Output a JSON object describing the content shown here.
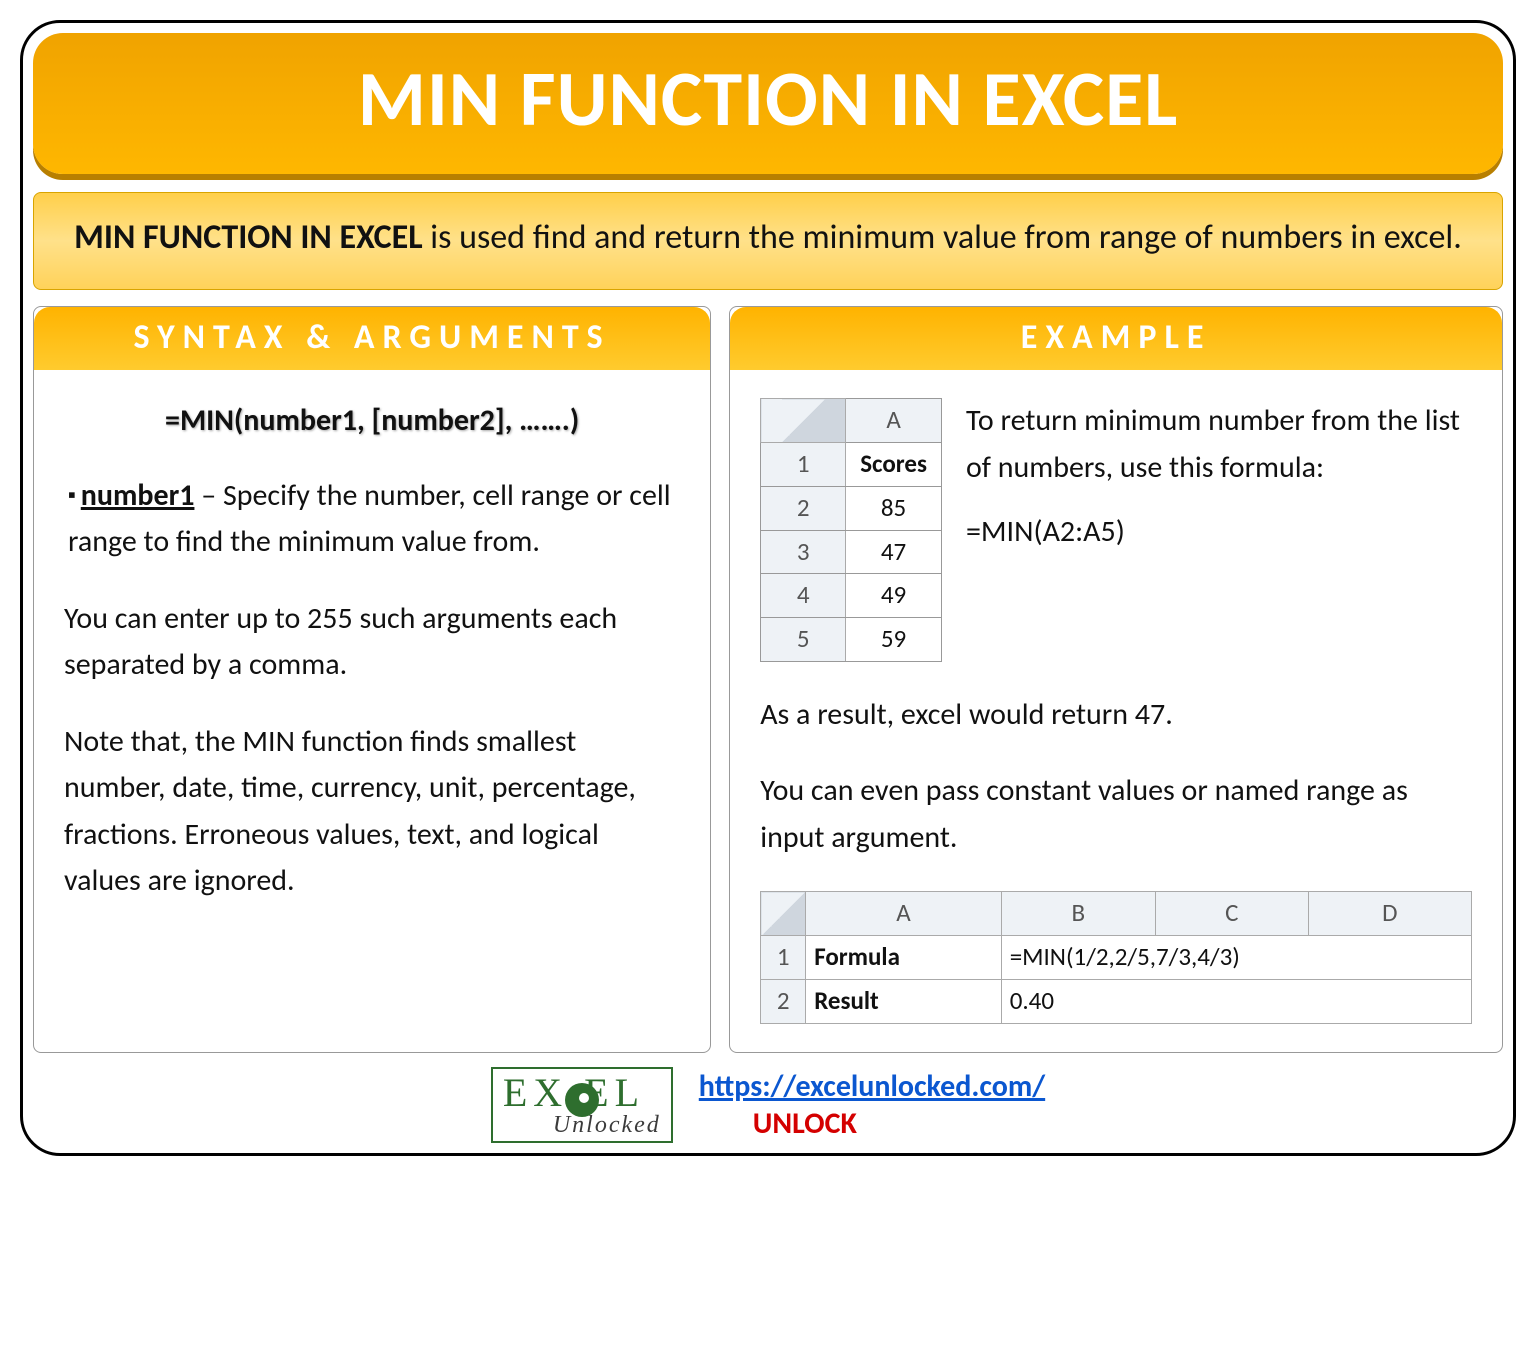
{
  "title": "MIN FUNCTION IN EXCEL",
  "subtitle": {
    "bold": "MIN FUNCTION IN EXCEL",
    "rest": " is used find and return the minimum value from range of numbers in excel."
  },
  "syntax": {
    "header": "SYNTAX & ARGUMENTS",
    "formula": "=MIN(number1, [number2], …….)",
    "arg_name": "number1",
    "arg_desc": " – Specify the number, cell range or cell range to find the minimum value from.",
    "p2": "You can enter up to 255 such arguments each separated by a comma.",
    "p3": "Note that, the MIN function finds smallest number, date, time, currency, unit, percentage, fractions. Erroneous values, text, and logical values are ignored."
  },
  "example": {
    "header": "EXAMPLE",
    "scores_col": "A",
    "scores_header": "Scores",
    "scores_rows": [
      "1",
      "2",
      "3",
      "4",
      "5"
    ],
    "scores": [
      "85",
      "47",
      "49",
      "59"
    ],
    "p1": "To return minimum number from the list of numbers, use this formula:",
    "formula": "=MIN(A2:A5)",
    "p2": "As a result, excel would return 47.",
    "p3": "You can even pass constant values or named range as input argument.",
    "wide_cols": [
      "A",
      "B",
      "C",
      "D"
    ],
    "wide_rows": [
      "1",
      "2"
    ],
    "wide_r1_label": "Formula",
    "wide_r1_val": "=MIN(1/2,2/5,7/3,4/3)",
    "wide_r2_label": "Result",
    "wide_r2_val": "0.40"
  },
  "footer": {
    "url": "https://excelunlocked.com/",
    "unlock": "UNLOCK",
    "brand1": "EX   EL",
    "brand2": "Unlocked"
  }
}
